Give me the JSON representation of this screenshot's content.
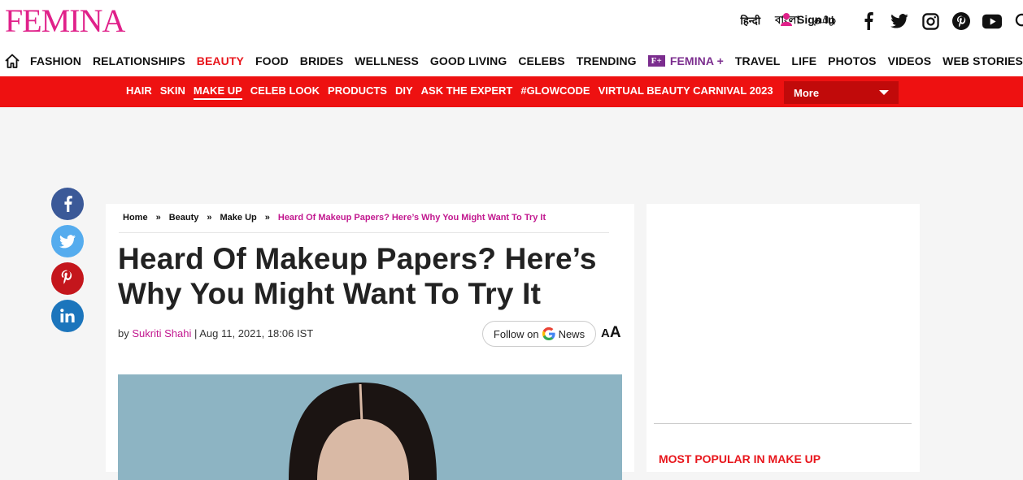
{
  "brand": {
    "logo_text": "FEMINA",
    "color": "#e0218a"
  },
  "header": {
    "languages": [
      "हिन्दी",
      "বাংলা",
      "தமிழ்"
    ],
    "sign_in": "Sign In",
    "social_icons": [
      "facebook-icon",
      "twitter-icon",
      "instagram-icon",
      "pinterest-icon",
      "youtube-icon",
      "search-icon"
    ]
  },
  "main_nav": {
    "items": [
      "FASHION",
      "RELATIONSHIPS",
      "BEAUTY",
      "FOOD",
      "BRIDES",
      "WELLNESS",
      "GOOD LIVING",
      "CELEBS",
      "TRENDING"
    ],
    "plus_badge": "F+",
    "plus_label": "FEMINA +",
    "items_after": [
      "TRAVEL",
      "LIFE",
      "PHOTOS",
      "VIDEOS",
      "WEB STORIES"
    ],
    "active": "BEAUTY",
    "active_color": "#e8161c"
  },
  "sub_nav": {
    "items": [
      "HAIR",
      "SKIN",
      "MAKE UP",
      "CELEB LOOK",
      "PRODUCTS",
      "DIY",
      "ASK THE EXPERT",
      "#GLOWCODE",
      "VIRTUAL BEAUTY CARNIVAL 2023"
    ],
    "active": "MAKE UP",
    "more_label": "More",
    "bg_color": "#ee1111"
  },
  "share": [
    "facebook-icon",
    "twitter-icon",
    "pinterest-icon",
    "linkedin-icon"
  ],
  "article": {
    "breadcrumb": [
      "Home",
      "»",
      "Beauty",
      "»",
      "Make Up",
      "»",
      "Heard Of Makeup Papers? Here’s Why You Might Want To Try It"
    ],
    "title": "Heard Of Makeup Papers? Here’s Why You Might Want To Try It",
    "by": "by",
    "author": "Sukriti Shahi",
    "date": " | Aug 11, 2021, 18:06 IST",
    "follow_prefix": "Follow on",
    "follow_suffix": "News",
    "font_small": "A",
    "font_big": "A"
  },
  "sidebar": {
    "section_title": "MOST POPULAR IN MAKE UP"
  }
}
